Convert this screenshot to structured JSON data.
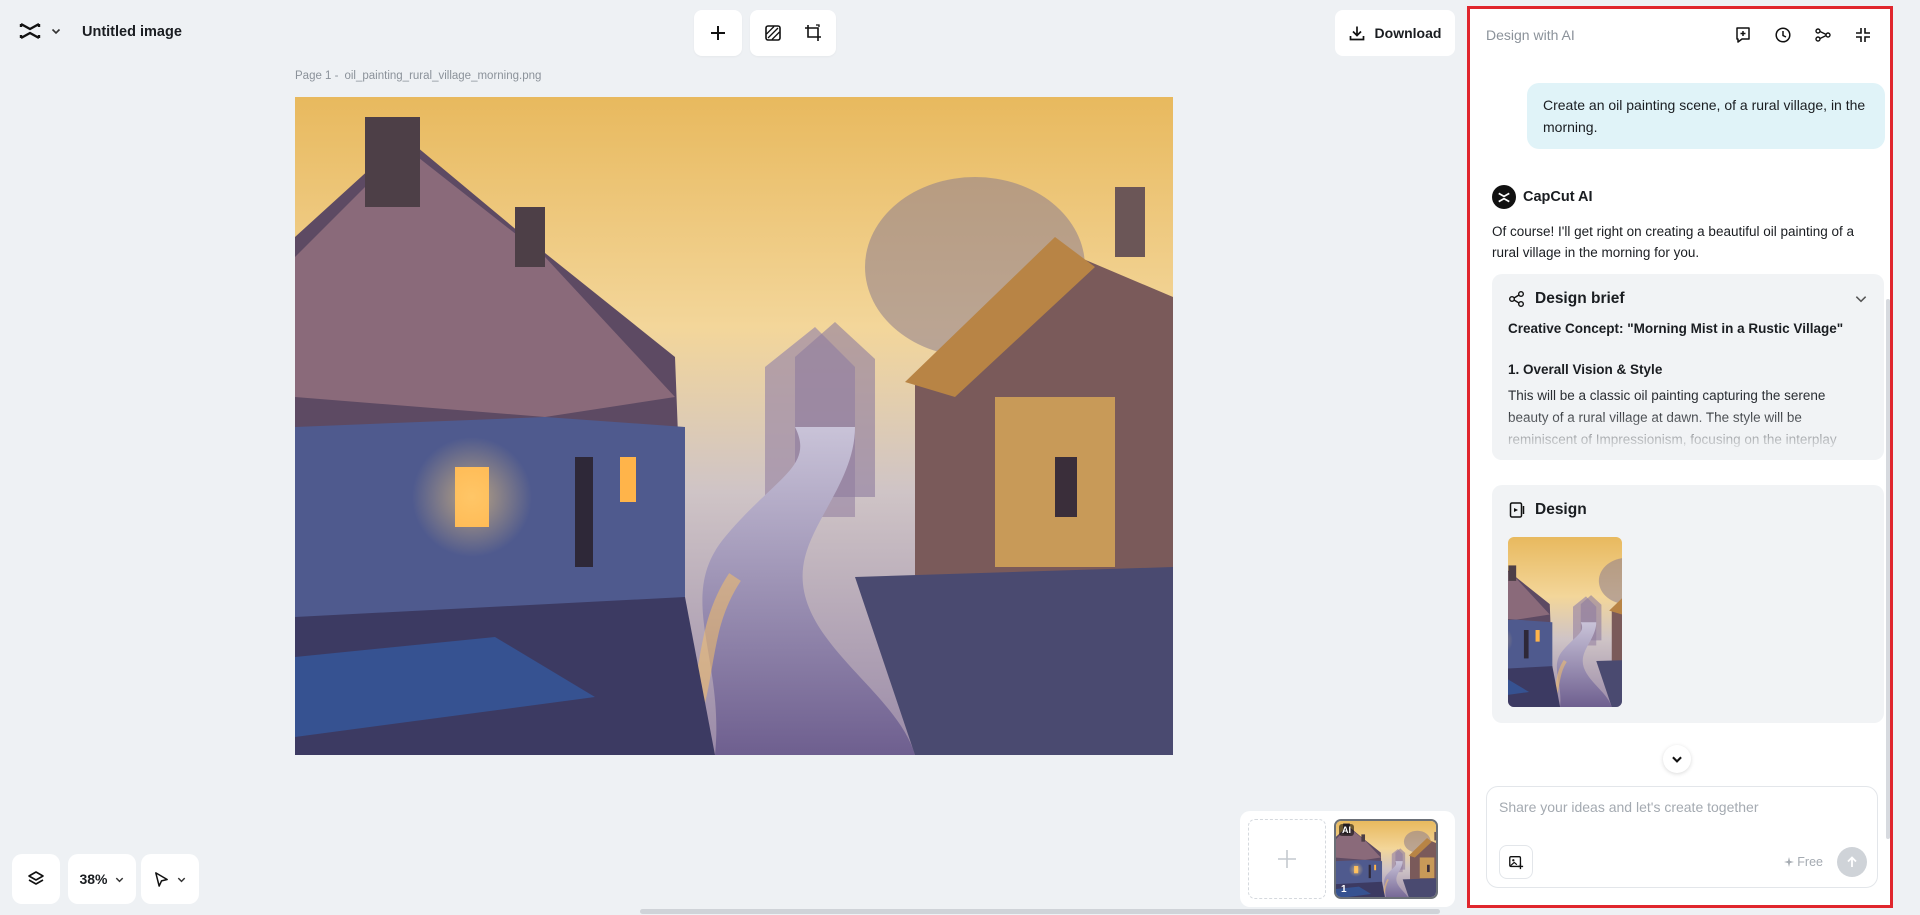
{
  "header": {
    "doc_title": "Untitled image",
    "download_label": "Download"
  },
  "canvas": {
    "page_prefix": "Page 1 -",
    "file_name": "oil_painting_rural_village_morning.png"
  },
  "bottom_controls": {
    "zoom": "38%"
  },
  "pages": {
    "ai_badge": "AI",
    "page_number": "1"
  },
  "panel": {
    "title": "Design with AI",
    "user_message": "Create an oil painting scene, of a rural village, in the morning.",
    "ai_name": "CapCut AI",
    "ai_reply": "Of course! I'll get right on creating a beautiful oil painting of a rural village in the morning for you.",
    "brief": {
      "title": "Design brief",
      "concept": "Creative Concept: \"Morning Mist in a Rustic Village\"",
      "section_heading": "1. Overall Vision & Style",
      "section_text": "This will be a classic oil painting capturing the serene beauty of a rural village at dawn. The style will be reminiscent of Impressionism, focusing on the interplay"
    },
    "design": {
      "title": "Design"
    },
    "composer": {
      "placeholder": "Share your ideas and let's create together",
      "free_label": "Free"
    }
  },
  "icons": {
    "logo": "capcut-logo-icon",
    "add": "plus-icon",
    "remove_bg": "remove-background-icon",
    "resize": "resize-icon",
    "download": "download-icon",
    "new_chat": "new-chat-icon",
    "history": "history-icon",
    "share": "share-icon",
    "collapse": "collapse-icon",
    "layers": "layers-icon",
    "select": "pointer-icon",
    "brief": "mind-map-icon",
    "design": "design-icon",
    "attach": "add-image-icon",
    "send": "send-arrow-icon"
  },
  "colors": {
    "highlight_border": "#e0262d",
    "user_bubble": "#e0f3f8",
    "card_bg": "#f1f3f5",
    "workspace_bg": "#eef1f4"
  }
}
